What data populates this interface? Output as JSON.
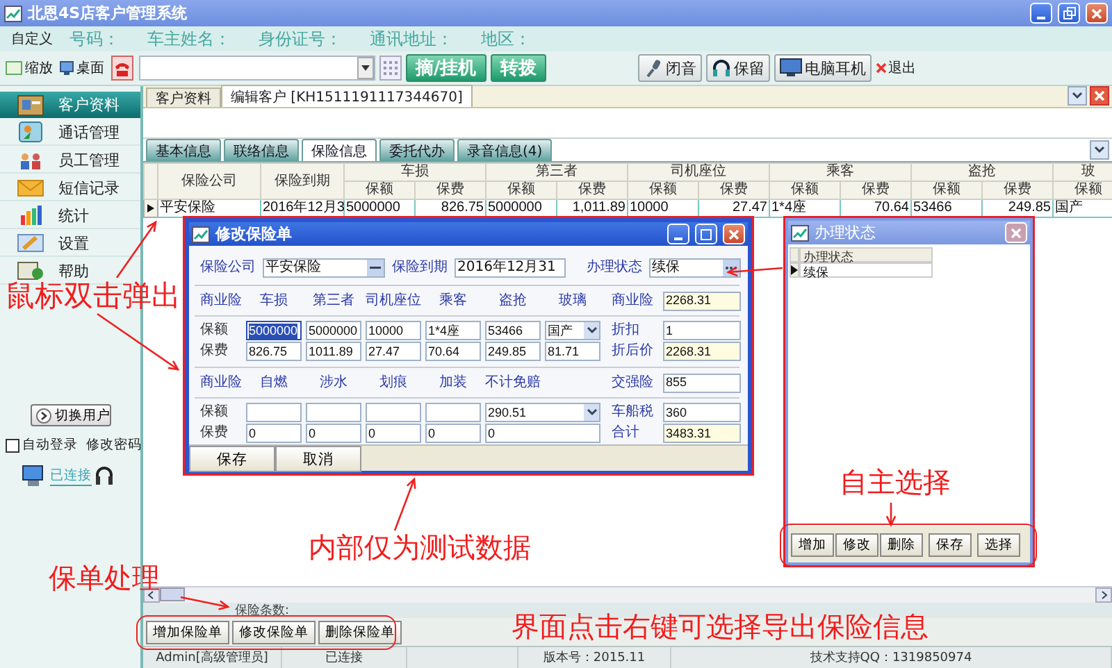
{
  "window": {
    "title": "北恩4S店客户管理系统"
  },
  "info_bar": {
    "custom_label": "自定义",
    "fields": [
      "号码：",
      "车主姓名：",
      "身份证号：",
      "通讯地址：",
      "地区："
    ]
  },
  "toolbar": {
    "view_options": [
      "缩放",
      "桌面"
    ],
    "call_buttons": [
      "摘/挂机",
      "转拨"
    ],
    "buttons": [
      "闭音",
      "保留",
      "电脑耳机"
    ],
    "exit": "退出"
  },
  "sidebar": {
    "items": [
      {
        "label": "客户资料",
        "selected": true
      },
      {
        "label": "通话管理",
        "selected": false
      },
      {
        "label": "员工管理",
        "selected": false
      },
      {
        "label": "短信记录",
        "selected": false
      },
      {
        "label": "统计",
        "selected": false
      },
      {
        "label": "设置",
        "selected": false
      },
      {
        "label": "帮助",
        "selected": false
      }
    ],
    "switch_user": "切换用户",
    "auto_login": {
      "label": "自动登录",
      "checked": false
    },
    "change_password": "修改密码",
    "connection": "已连接"
  },
  "tabs": [
    {
      "label": "客户资料",
      "selected": false
    },
    {
      "label": "编辑客户 [KH1511191117344670]",
      "selected": true
    }
  ],
  "sub_tabs": [
    {
      "label": "基本信息",
      "selected": false
    },
    {
      "label": "联络信息",
      "selected": false
    },
    {
      "label": "保险信息",
      "selected": true
    },
    {
      "label": "委托代办",
      "selected": false
    },
    {
      "label": "录音信息(4)",
      "selected": false
    }
  ],
  "table": {
    "columns": [
      "保险公司",
      "保险到期"
    ],
    "groups": [
      {
        "label": "车损",
        "columns": [
          "保额",
          "保费"
        ]
      },
      {
        "label": "第三者",
        "columns": [
          "保额",
          "保费"
        ]
      },
      {
        "label": "司机座位",
        "columns": [
          "保额",
          "保费"
        ]
      },
      {
        "label": "乘客",
        "columns": [
          "保额",
          "保费"
        ]
      },
      {
        "label": "盗抢",
        "columns": [
          "保额",
          "保费"
        ]
      },
      {
        "label": "玻",
        "columns": [
          "保额"
        ]
      }
    ],
    "rows": [
      {
        "selected": true,
        "cells": [
          "平安保险",
          "2016年12月3",
          "5000000",
          "826.75",
          "5000000",
          "1,011.89",
          "10000",
          "27.47",
          "1*4座",
          "70.64",
          "53466",
          "249.85",
          "国产"
        ]
      }
    ]
  },
  "edit_dialog": {
    "title": "修改保险单",
    "company": {
      "label": "保险公司",
      "value": "平安保险"
    },
    "expiry": {
      "label": "保险到期",
      "value": "2016年12月31"
    },
    "status": {
      "label": "办理状态",
      "value": "续保"
    },
    "section_1": {
      "headers": [
        "商业险",
        "车损",
        "第三者",
        "司机座位",
        "乘客",
        "盗抢",
        "玻璃"
      ],
      "rows": [
        {
          "label": "保额",
          "cells": [
            {
              "value": "5000000",
              "kind": "text",
              "focused": true
            },
            {
              "value": "5000000",
              "kind": "text",
              "focused": false
            },
            {
              "value": "10000",
              "kind": "text",
              "focused": false
            },
            {
              "value": "1*4座",
              "kind": "text",
              "focused": false
            },
            {
              "value": "53466",
              "kind": "text",
              "focused": false
            },
            {
              "value": "国产",
              "kind": "select",
              "focused": false
            }
          ]
        },
        {
          "label": "保费",
          "cells": [
            {
              "value": "826.75",
              "kind": "text",
              "focused": false
            },
            {
              "value": "1011.89",
              "kind": "text",
              "focused": false
            },
            {
              "value": "27.47",
              "kind": "text",
              "focused": false
            },
            {
              "value": "70.64",
              "kind": "text",
              "focused": false
            },
            {
              "value": "249.85",
              "kind": "text",
              "focused": false
            },
            {
              "value": "81.71",
              "kind": "text",
              "focused": false
            }
          ]
        }
      ],
      "totals": [
        {
          "label": "商业险",
          "value": "2268.31",
          "readonly": true
        },
        {
          "label": "折扣",
          "value": "1",
          "readonly": false
        },
        {
          "label": "折后价",
          "value": "2268.31",
          "readonly": true
        }
      ]
    },
    "section_2": {
      "headers": [
        "商业险",
        "自燃",
        "涉水",
        "划痕",
        "加装",
        "不计免赔"
      ],
      "rows": [
        {
          "label": "保额",
          "cells": [
            {
              "kind": "text",
              "focused": false
            },
            {
              "kind": "text",
              "focused": false
            },
            {
              "kind": "text",
              "focused": false
            },
            {
              "kind": "text",
              "focused": false
            },
            {
              "value": "290.51",
              "kind": "select",
              "focused": false,
              "wide": true
            }
          ]
        },
        {
          "label": "保费",
          "cells": [
            {
              "value": "0",
              "kind": "text",
              "focused": false
            },
            {
              "value": "0",
              "kind": "text",
              "focused": false
            },
            {
              "value": "0",
              "kind": "text",
              "focused": false
            },
            {
              "value": "0",
              "kind": "text",
              "focused": false
            },
            {
              "value": "0",
              "kind": "text",
              "focused": false,
              "wide": true
            }
          ]
        }
      ],
      "totals": [
        {
          "label": "交强险",
          "value": "855",
          "readonly": false
        },
        {
          "label": "车船税",
          "value": "360",
          "readonly": false
        },
        {
          "label": "合计",
          "value": "3483.31",
          "readonly": true
        }
      ]
    },
    "buttons": [
      "保存",
      "取消"
    ]
  },
  "status_dialog": {
    "title": "办理状态",
    "column": "办理状态",
    "rows": [
      {
        "label": "续保",
        "selected": true
      }
    ],
    "buttons": [
      "增加",
      "修改",
      "删除",
      "保存",
      "选择"
    ]
  },
  "footer": {
    "count_label": "保险条数:",
    "buttons": [
      "增加保险单",
      "修改保险单",
      "删除保险单"
    ]
  },
  "status_bar": [
    "Admin[高级管理员]",
    "已连接",
    "版本号：2015.11",
    "技术支持QQ：1319850974"
  ],
  "annotations": [
    "鼠标双击弹出",
    "内部仅为测试数据",
    "自主选择",
    "保单处理",
    "界面点击右键可选择导出保险信息"
  ]
}
